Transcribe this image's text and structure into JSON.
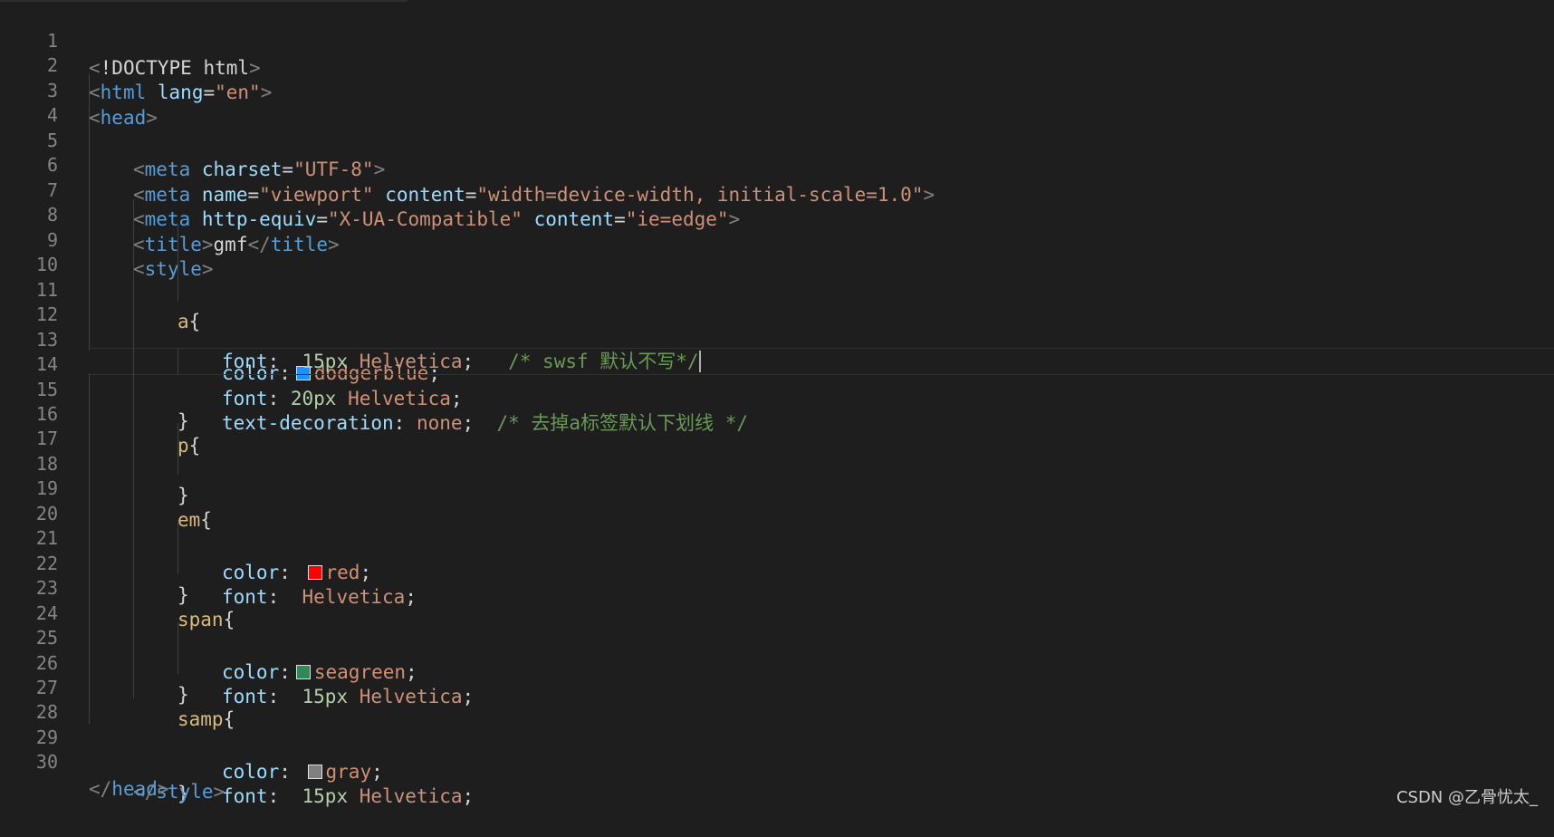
{
  "editor": {
    "line_numbers": [
      "1",
      "2",
      "3",
      "4",
      "5",
      "6",
      "7",
      "8",
      "9",
      "10",
      "11",
      "12",
      "13",
      "14",
      "15",
      "16",
      "17",
      "18",
      "19",
      "20",
      "21",
      "22",
      "23",
      "24",
      "25",
      "26",
      "27",
      "28",
      "29",
      "30"
    ],
    "current_line": "15",
    "lines": {
      "l1": {
        "a": "<",
        "b": "!DOCTYPE html",
        "c": ">"
      },
      "l2": {
        "a": "<",
        "b": "html",
        "c": "lang",
        "d": "=",
        "e": "\"en\"",
        "f": ">"
      },
      "l3": {
        "a": "<",
        "b": "head",
        "c": ">"
      },
      "l4": {
        "a": "<",
        "b": "meta",
        "c": "charset",
        "d": "=",
        "e": "\"UTF-8\"",
        "f": ">"
      },
      "l5": {
        "a": "<",
        "b": "meta",
        "c": "name",
        "d": "=",
        "e": "\"viewport\"",
        "g": "content",
        "h": "=",
        "i": "\"width=device-width, initial-scale=1.0\"",
        "f": ">"
      },
      "l6": {
        "a": "<",
        "b": "meta",
        "c": "http-equiv",
        "d": "=",
        "e": "\"X-UA-Compatible\"",
        "g": "content",
        "h": "=",
        "i": "\"ie=edge\"",
        "f": ">"
      },
      "l7": {
        "a": "<",
        "b": "title",
        "c": ">",
        "t": "gmf",
        "d": "</",
        "e": "title",
        "f": ">"
      },
      "l8": {
        "a": "<",
        "b": "style",
        "c": ">"
      },
      "l9": {
        "s": "a",
        "o": "{"
      },
      "l10": {
        "p": "color",
        "c": ":",
        "v": "dodgerblue",
        "e": ";",
        "swatch": "#1e90ff"
      },
      "l11": {
        "p": "font",
        "c": ": ",
        "n": "20px",
        "v": " Helvetica",
        "e": ";"
      },
      "l12": {
        "p": "text-decoration",
        "c": ": ",
        "v": "none",
        "e": ";",
        "m": "  /* 去掉a标签默认下划线 */"
      },
      "l13": {
        "o": "}"
      },
      "l14": {
        "s": "p",
        "o": "{"
      },
      "l15": {
        "p": "font",
        "c": ":  ",
        "n": "15px",
        "v": " Helvetica",
        "e": ";",
        "m": "   /* swsf 默认不写*/"
      },
      "l16": {
        "o": "}"
      },
      "l17": {
        "s": "em",
        "o": "{"
      },
      "l18": {
        "p": "color",
        "c": ": ",
        "v": "red",
        "e": ";",
        "swatch": "#ff0000"
      },
      "l19": {
        "p": "font",
        "c": ":  ",
        "v": "Helvetica",
        "e": ";"
      },
      "l20": {
        "o": "}"
      },
      "l21": {
        "s": "span",
        "o": "{"
      },
      "l22": {
        "p": "color",
        "c": ":",
        "v": "seagreen",
        "e": ";",
        "swatch": "#2e8b57"
      },
      "l23": {
        "p": "font",
        "c": ":  ",
        "n": "15px",
        "v": " Helvetica",
        "e": ";"
      },
      "l24": {
        "o": "}"
      },
      "l25": {
        "s": "samp",
        "o": "{"
      },
      "l26": {
        "p": "color",
        "c": ": ",
        "v": "gray",
        "e": ";",
        "swatch": "#808080"
      },
      "l27": {
        "p": "font",
        "c": ":  ",
        "n": "15px",
        "v": " Helvetica",
        "e": ";"
      },
      "l28": {
        "o": "}"
      },
      "l29": {
        "a": "</",
        "b": "style",
        "c": ">"
      },
      "l30": {
        "a": "</",
        "b": "head",
        "c": ">"
      }
    }
  },
  "watermark": "CSDN @乙骨忧太_"
}
